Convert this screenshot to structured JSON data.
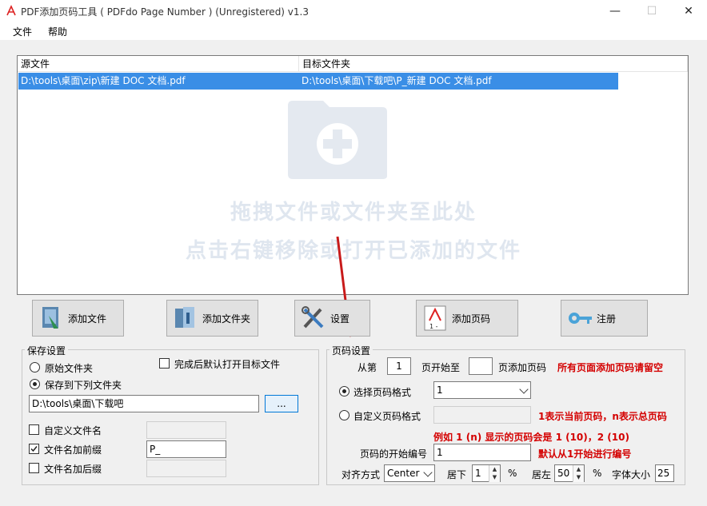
{
  "window": {
    "title": "PDF添加页码工具 ( PDFdo Page Number ) (Unregistered) v1.3"
  },
  "menu": {
    "file": "文件",
    "help": "帮助"
  },
  "file_list": {
    "col_source": "源文件",
    "col_target": "目标文件夹",
    "rows": [
      {
        "source": "D:\\tools\\桌面\\zip\\新建 DOC 文档.pdf",
        "target": "D:\\tools\\桌面\\下载吧\\P_新建 DOC 文档.pdf"
      }
    ],
    "drop_hint_1": "拖拽文件或文件夹至此处",
    "drop_hint_2": "点击右键移除或打开已添加的文件"
  },
  "toolbar": {
    "add_file": "添加文件",
    "add_folder": "添加文件夹",
    "settings": "设置",
    "add_page_number": "添加页码",
    "register": "注册"
  },
  "save_settings": {
    "title": "保存设置",
    "original_folder": "原始文件夹",
    "save_to_folder": "保存到下列文件夹",
    "open_after": "完成后默认打开目标文件",
    "folder_path": "D:\\tools\\桌面\\下载吧",
    "browse": "...",
    "custom_name": "自定义文件名",
    "prefix_label": "文件名加前缀",
    "prefix_value": "P_",
    "suffix_label": "文件名加后缀"
  },
  "page_settings": {
    "title": "页码设置",
    "from_label": "从第",
    "from_value": "1",
    "start_to_label": "页开始至",
    "to_value": "",
    "add_label": "页添加页码",
    "hint_all": "所有页面添加页码请留空",
    "select_format_label": "选择页码格式",
    "format_value": "1",
    "custom_format_label": "自定义页码格式",
    "hint_custom": "1表示当前页码，n表示总页码",
    "hint_example": "例如 1 (n) 显示的页码会是 1 (10)，2 (10)",
    "start_number_label": "页码的开始编号",
    "start_number_value": "1",
    "hint_start": "默认从1开始进行编号",
    "align_label": "对齐方式",
    "align_value": "Center",
    "bottom_label": "居下",
    "bottom_value": "1",
    "percent": "%",
    "left_label": "居左",
    "left_value": "50",
    "font_size_label": "字体大小",
    "font_size_value": "25"
  },
  "colors": {
    "selection": "#3a8ee6",
    "hint_red": "#d40000"
  }
}
